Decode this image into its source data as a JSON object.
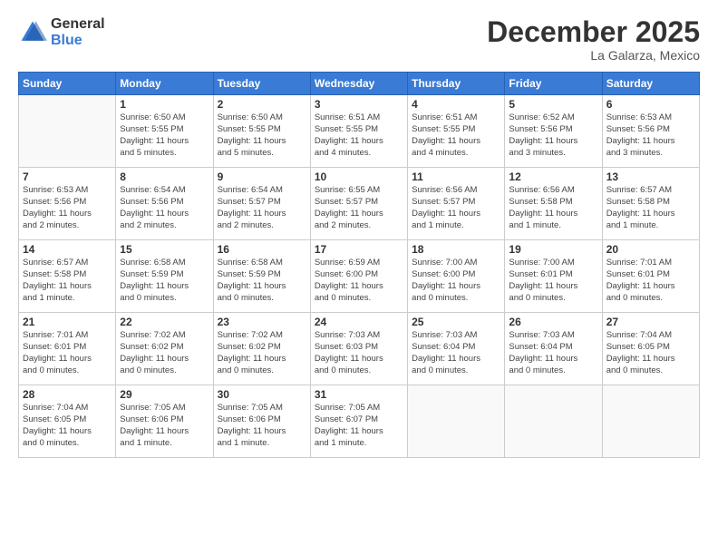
{
  "logo": {
    "general": "General",
    "blue": "Blue"
  },
  "title": "December 2025",
  "location": "La Galarza, Mexico",
  "days_of_week": [
    "Sunday",
    "Monday",
    "Tuesday",
    "Wednesday",
    "Thursday",
    "Friday",
    "Saturday"
  ],
  "weeks": [
    [
      {
        "day": "",
        "info": ""
      },
      {
        "day": "1",
        "info": "Sunrise: 6:50 AM\nSunset: 5:55 PM\nDaylight: 11 hours\nand 5 minutes."
      },
      {
        "day": "2",
        "info": "Sunrise: 6:50 AM\nSunset: 5:55 PM\nDaylight: 11 hours\nand 5 minutes."
      },
      {
        "day": "3",
        "info": "Sunrise: 6:51 AM\nSunset: 5:55 PM\nDaylight: 11 hours\nand 4 minutes."
      },
      {
        "day": "4",
        "info": "Sunrise: 6:51 AM\nSunset: 5:55 PM\nDaylight: 11 hours\nand 4 minutes."
      },
      {
        "day": "5",
        "info": "Sunrise: 6:52 AM\nSunset: 5:56 PM\nDaylight: 11 hours\nand 3 minutes."
      },
      {
        "day": "6",
        "info": "Sunrise: 6:53 AM\nSunset: 5:56 PM\nDaylight: 11 hours\nand 3 minutes."
      }
    ],
    [
      {
        "day": "7",
        "info": "Sunrise: 6:53 AM\nSunset: 5:56 PM\nDaylight: 11 hours\nand 2 minutes."
      },
      {
        "day": "8",
        "info": "Sunrise: 6:54 AM\nSunset: 5:56 PM\nDaylight: 11 hours\nand 2 minutes."
      },
      {
        "day": "9",
        "info": "Sunrise: 6:54 AM\nSunset: 5:57 PM\nDaylight: 11 hours\nand 2 minutes."
      },
      {
        "day": "10",
        "info": "Sunrise: 6:55 AM\nSunset: 5:57 PM\nDaylight: 11 hours\nand 2 minutes."
      },
      {
        "day": "11",
        "info": "Sunrise: 6:56 AM\nSunset: 5:57 PM\nDaylight: 11 hours\nand 1 minute."
      },
      {
        "day": "12",
        "info": "Sunrise: 6:56 AM\nSunset: 5:58 PM\nDaylight: 11 hours\nand 1 minute."
      },
      {
        "day": "13",
        "info": "Sunrise: 6:57 AM\nSunset: 5:58 PM\nDaylight: 11 hours\nand 1 minute."
      }
    ],
    [
      {
        "day": "14",
        "info": "Sunrise: 6:57 AM\nSunset: 5:58 PM\nDaylight: 11 hours\nand 1 minute."
      },
      {
        "day": "15",
        "info": "Sunrise: 6:58 AM\nSunset: 5:59 PM\nDaylight: 11 hours\nand 0 minutes."
      },
      {
        "day": "16",
        "info": "Sunrise: 6:58 AM\nSunset: 5:59 PM\nDaylight: 11 hours\nand 0 minutes."
      },
      {
        "day": "17",
        "info": "Sunrise: 6:59 AM\nSunset: 6:00 PM\nDaylight: 11 hours\nand 0 minutes."
      },
      {
        "day": "18",
        "info": "Sunrise: 7:00 AM\nSunset: 6:00 PM\nDaylight: 11 hours\nand 0 minutes."
      },
      {
        "day": "19",
        "info": "Sunrise: 7:00 AM\nSunset: 6:01 PM\nDaylight: 11 hours\nand 0 minutes."
      },
      {
        "day": "20",
        "info": "Sunrise: 7:01 AM\nSunset: 6:01 PM\nDaylight: 11 hours\nand 0 minutes."
      }
    ],
    [
      {
        "day": "21",
        "info": "Sunrise: 7:01 AM\nSunset: 6:01 PM\nDaylight: 11 hours\nand 0 minutes."
      },
      {
        "day": "22",
        "info": "Sunrise: 7:02 AM\nSunset: 6:02 PM\nDaylight: 11 hours\nand 0 minutes."
      },
      {
        "day": "23",
        "info": "Sunrise: 7:02 AM\nSunset: 6:02 PM\nDaylight: 11 hours\nand 0 minutes."
      },
      {
        "day": "24",
        "info": "Sunrise: 7:03 AM\nSunset: 6:03 PM\nDaylight: 11 hours\nand 0 minutes."
      },
      {
        "day": "25",
        "info": "Sunrise: 7:03 AM\nSunset: 6:04 PM\nDaylight: 11 hours\nand 0 minutes."
      },
      {
        "day": "26",
        "info": "Sunrise: 7:03 AM\nSunset: 6:04 PM\nDaylight: 11 hours\nand 0 minutes."
      },
      {
        "day": "27",
        "info": "Sunrise: 7:04 AM\nSunset: 6:05 PM\nDaylight: 11 hours\nand 0 minutes."
      }
    ],
    [
      {
        "day": "28",
        "info": "Sunrise: 7:04 AM\nSunset: 6:05 PM\nDaylight: 11 hours\nand 0 minutes."
      },
      {
        "day": "29",
        "info": "Sunrise: 7:05 AM\nSunset: 6:06 PM\nDaylight: 11 hours\nand 1 minute."
      },
      {
        "day": "30",
        "info": "Sunrise: 7:05 AM\nSunset: 6:06 PM\nDaylight: 11 hours\nand 1 minute."
      },
      {
        "day": "31",
        "info": "Sunrise: 7:05 AM\nSunset: 6:07 PM\nDaylight: 11 hours\nand 1 minute."
      },
      {
        "day": "",
        "info": ""
      },
      {
        "day": "",
        "info": ""
      },
      {
        "day": "",
        "info": ""
      }
    ]
  ]
}
